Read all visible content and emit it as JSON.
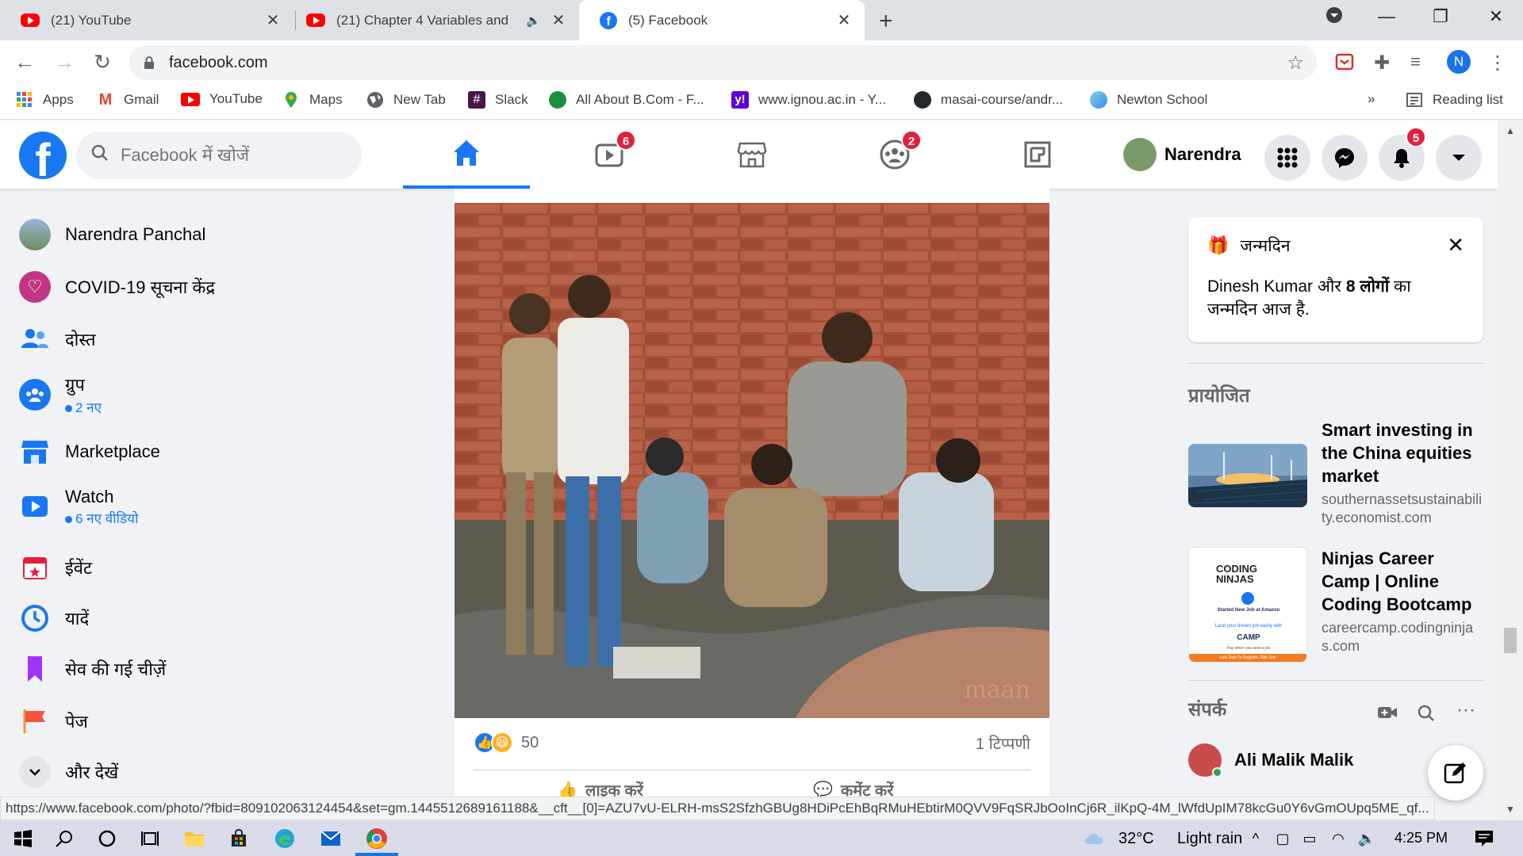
{
  "browser": {
    "tabs": [
      {
        "title": "(21) YouTube",
        "favicon": "youtube-icon",
        "active": false
      },
      {
        "title": "(21) Chapter 4 Variables and",
        "favicon": "youtube-icon",
        "active": false,
        "audio": true
      },
      {
        "title": "(5) Facebook",
        "favicon": "facebook-icon",
        "active": true
      }
    ],
    "url": "facebook.com",
    "profile_initial": "N",
    "bookmarks": [
      {
        "label": "Apps",
        "icon": "apps-grid-icon"
      },
      {
        "label": "Gmail",
        "icon": "gmail-icon"
      },
      {
        "label": "YouTube",
        "icon": "youtube-icon"
      },
      {
        "label": "Maps",
        "icon": "maps-icon"
      },
      {
        "label": "New Tab",
        "icon": "globe-icon"
      },
      {
        "label": "Slack",
        "icon": "slack-icon"
      },
      {
        "label": "All About B.Com - F...",
        "icon": "site-icon"
      },
      {
        "label": "www.ignou.ac.in - Y...",
        "icon": "yahoo-icon"
      },
      {
        "label": "masai-course/andr...",
        "icon": "github-icon"
      },
      {
        "label": "Newton School",
        "icon": "newton-icon"
      }
    ],
    "bookmarks_overflow": "»",
    "reading_list": "Reading list",
    "status_url": "https://www.facebook.com/photo/?fbid=809102063124454&set=gm.1445512689161188&__cft__[0]=AZU7vU-ELRH-msS2SfzhGBUg8HDiPcEhBqRMuHEbtirM0QVV9FqSRJbOoInCj6R_ilKpQ-4M_lWfdUpIM78kcGu0Y6vGmOUpq5ME_qf..."
  },
  "facebook": {
    "search_placeholder": "Facebook में खोजें",
    "nav_badges": {
      "watch": "6",
      "groups": "2"
    },
    "profile_name": "Narendra",
    "notification_badge": "5",
    "left_nav": [
      {
        "label": "Narendra Panchal",
        "icon": "avatar"
      },
      {
        "label": "COVID-19 सूचना केंद्र",
        "icon": "covid-heart-icon"
      },
      {
        "label": "दोस्त",
        "icon": "friends-icon"
      },
      {
        "label": "ग्रुप",
        "icon": "groups-icon",
        "sub": "2 नए"
      },
      {
        "label": "Marketplace",
        "icon": "marketplace-icon"
      },
      {
        "label": "Watch",
        "icon": "watch-icon",
        "sub": "6 नए वीडियो"
      },
      {
        "label": "ईवेंट",
        "icon": "events-icon"
      },
      {
        "label": "यादें",
        "icon": "memories-icon"
      },
      {
        "label": "सेव की गई चीज़ें",
        "icon": "saved-icon"
      },
      {
        "label": "पेज",
        "icon": "pages-icon"
      },
      {
        "label": "और देखें",
        "icon": "chevron-down-icon"
      }
    ],
    "post": {
      "watermark": "maan",
      "reaction_count": "50",
      "comment_count": "1 टिप्पणी",
      "like_label": "लाइक करें",
      "comment_label": "कमेंट करें"
    },
    "birthday": {
      "heading": "जन्मदिन",
      "name": "Dinesh Kumar",
      "and": "और",
      "others": "8 लोगों",
      "suffix": "का जन्मदिन आज है."
    },
    "sponsored_heading": "प्रायोजित",
    "ads": [
      {
        "title": "Smart investing in the China equities market",
        "domain": "southernassetsustainability.economist.com"
      },
      {
        "title": "Ninjas Career Camp | Online Coding Bootcamp",
        "domain": "careercamp.codingninjas.com"
      }
    ],
    "ad_thumb_text": {
      "brand": "CODING NINJAS",
      "line1": "Started New Job at Amazon",
      "line2": "Land your dream job easily with",
      "camp": "CAMP",
      "line3": "Pay when you land a job",
      "footer": "Last Date To Register: 29th July"
    },
    "contacts_heading": "संपर्क",
    "contacts": [
      {
        "name": "Ali Malik Malik"
      }
    ]
  },
  "taskbar": {
    "weather_temp": "32°C",
    "weather_desc": "Light rain",
    "time": "4:25 PM"
  },
  "colors": {
    "facebook_blue": "#1877f2",
    "badge_red": "#e41e3f",
    "page_bg": "#f0f2f5"
  }
}
